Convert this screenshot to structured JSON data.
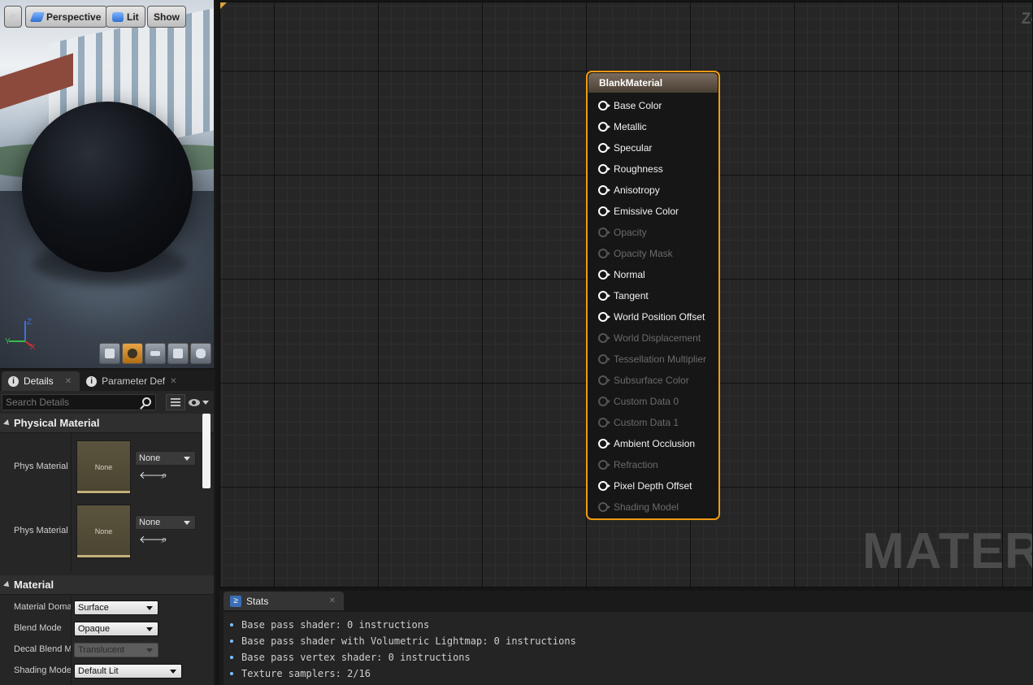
{
  "viewport": {
    "buttons": {
      "menu": "",
      "perspective": "Perspective",
      "lit": "Lit",
      "show": "Show"
    },
    "axis": {
      "z": "Z",
      "y": "Y",
      "x": "X"
    },
    "tools": [
      {
        "icon": "cylinder-icon"
      },
      {
        "icon": "sphere-icon",
        "active": true
      },
      {
        "icon": "plane-icon"
      },
      {
        "icon": "cube-icon"
      },
      {
        "icon": "custom-mesh-icon"
      }
    ]
  },
  "details": {
    "tabs": [
      {
        "label": "Details",
        "active": true
      },
      {
        "label": "Parameter Def",
        "active": false
      }
    ],
    "search": {
      "placeholder": "Search Details"
    },
    "physical_material": {
      "title": "Physical Material",
      "rows": [
        {
          "label": "Phys Material",
          "thumb": "None",
          "value": "None"
        },
        {
          "label": "Phys Material",
          "thumb": "None",
          "value": "None"
        }
      ]
    },
    "material": {
      "title": "Material",
      "rows": [
        {
          "label": "Material Doma",
          "value": "Surface"
        },
        {
          "label": "Blend Mode",
          "value": "Opaque"
        },
        {
          "label": "Decal Blend M",
          "value": "Translucent"
        },
        {
          "label": "Shading Mode",
          "value": "Default Lit"
        }
      ]
    }
  },
  "graph": {
    "zoom_label": "Zo",
    "watermark": "MATERIA",
    "node": {
      "title": "BlankMaterial",
      "pins": [
        {
          "label": "Base Color",
          "enabled": true
        },
        {
          "label": "Metallic",
          "enabled": true
        },
        {
          "label": "Specular",
          "enabled": true
        },
        {
          "label": "Roughness",
          "enabled": true
        },
        {
          "label": "Anisotropy",
          "enabled": true
        },
        {
          "label": "Emissive Color",
          "enabled": true
        },
        {
          "label": "Opacity",
          "enabled": false
        },
        {
          "label": "Opacity Mask",
          "enabled": false
        },
        {
          "label": "Normal",
          "enabled": true
        },
        {
          "label": "Tangent",
          "enabled": true
        },
        {
          "label": "World Position Offset",
          "enabled": true
        },
        {
          "label": "World Displacement",
          "enabled": false
        },
        {
          "label": "Tessellation Multiplier",
          "enabled": false
        },
        {
          "label": "Subsurface Color",
          "enabled": false
        },
        {
          "label": "Custom Data 0",
          "enabled": false
        },
        {
          "label": "Custom Data 1",
          "enabled": false
        },
        {
          "label": "Ambient Occlusion",
          "enabled": true
        },
        {
          "label": "Refraction",
          "enabled": false
        },
        {
          "label": "Pixel Depth Offset",
          "enabled": true
        },
        {
          "label": "Shading Model",
          "enabled": false
        }
      ]
    }
  },
  "stats": {
    "tab": "Stats",
    "lines": [
      "Base pass shader: 0 instructions",
      "Base pass shader with Volumetric Lightmap: 0 instructions",
      "Base pass vertex shader: 0 instructions",
      "Texture samplers: 2/16"
    ]
  },
  "colors": {
    "node_border": "#f29a12",
    "active_tool": "#e8a447",
    "accent_blue": "#3a6fb7"
  }
}
